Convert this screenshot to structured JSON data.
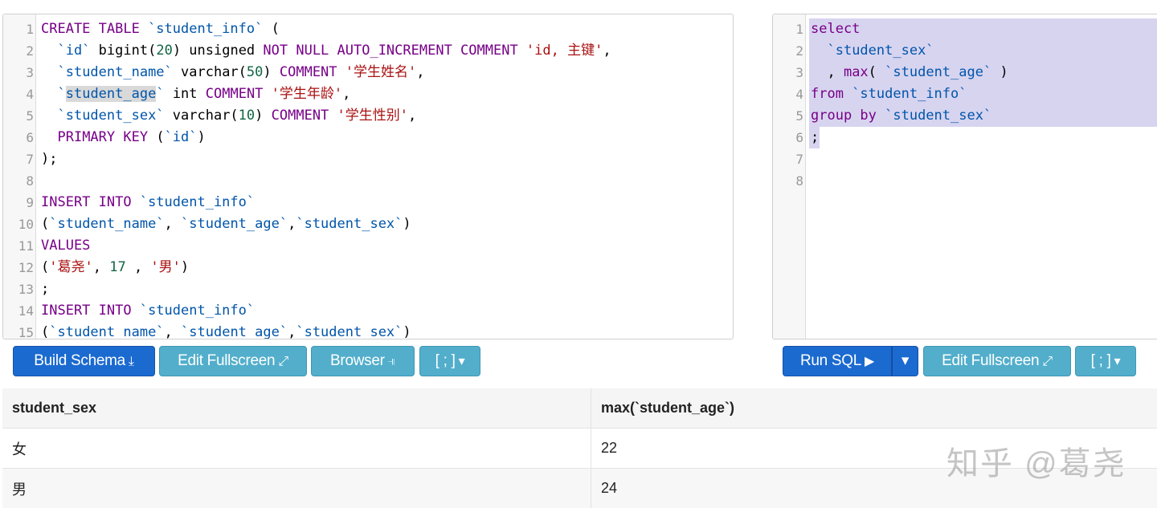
{
  "schema": {
    "lines": [
      {
        "n": "1",
        "parts": [
          {
            "t": "CREATE TABLE ",
            "c": "kw"
          },
          {
            "t": "`student_info`",
            "c": "var"
          },
          {
            "t": " (",
            "c": ""
          }
        ]
      },
      {
        "n": "2",
        "parts": [
          {
            "t": "  ",
            "c": ""
          },
          {
            "t": "`id`",
            "c": "var"
          },
          {
            "t": " bigint(",
            "c": ""
          },
          {
            "t": "20",
            "c": "num"
          },
          {
            "t": ") unsigned ",
            "c": ""
          },
          {
            "t": "NOT NULL AUTO_INCREMENT COMMENT ",
            "c": "kw"
          },
          {
            "t": "'id, 主键'",
            "c": "str"
          },
          {
            "t": ",",
            "c": ""
          }
        ]
      },
      {
        "n": "3",
        "parts": [
          {
            "t": "  ",
            "c": ""
          },
          {
            "t": "`student_name`",
            "c": "var"
          },
          {
            "t": " varchar(",
            "c": ""
          },
          {
            "t": "50",
            "c": "num"
          },
          {
            "t": ") ",
            "c": ""
          },
          {
            "t": "COMMENT ",
            "c": "kw"
          },
          {
            "t": "'学生姓名'",
            "c": "str"
          },
          {
            "t": ",",
            "c": ""
          }
        ]
      },
      {
        "n": "4",
        "parts": [
          {
            "t": "  ",
            "c": ""
          },
          {
            "t": "`",
            "c": "var"
          },
          {
            "t": "student_age",
            "c": "var hl"
          },
          {
            "t": "`",
            "c": "var"
          },
          {
            "t": " int ",
            "c": ""
          },
          {
            "t": "COMMENT ",
            "c": "kw"
          },
          {
            "t": "'学生年龄'",
            "c": "str"
          },
          {
            "t": ",",
            "c": ""
          }
        ]
      },
      {
        "n": "5",
        "parts": [
          {
            "t": "  ",
            "c": ""
          },
          {
            "t": "`student_sex`",
            "c": "var"
          },
          {
            "t": " varchar(",
            "c": ""
          },
          {
            "t": "10",
            "c": "num"
          },
          {
            "t": ") ",
            "c": ""
          },
          {
            "t": "COMMENT ",
            "c": "kw"
          },
          {
            "t": "'学生性别'",
            "c": "str"
          },
          {
            "t": ",",
            "c": ""
          }
        ]
      },
      {
        "n": "6",
        "parts": [
          {
            "t": "  ",
            "c": ""
          },
          {
            "t": "PRIMARY KEY",
            "c": "kw"
          },
          {
            "t": " (",
            "c": ""
          },
          {
            "t": "`id`",
            "c": "var"
          },
          {
            "t": ")",
            "c": ""
          }
        ]
      },
      {
        "n": "7",
        "parts": [
          {
            "t": ");",
            "c": ""
          }
        ]
      },
      {
        "n": "8",
        "parts": []
      },
      {
        "n": "9",
        "parts": [
          {
            "t": "INSERT INTO ",
            "c": "kw"
          },
          {
            "t": "`student_info`",
            "c": "var"
          }
        ]
      },
      {
        "n": "10",
        "parts": [
          {
            "t": "(",
            "c": ""
          },
          {
            "t": "`student_name`",
            "c": "var"
          },
          {
            "t": ", ",
            "c": ""
          },
          {
            "t": "`student_age`",
            "c": "var"
          },
          {
            "t": ",",
            "c": ""
          },
          {
            "t": "`student_sex`",
            "c": "var"
          },
          {
            "t": ")",
            "c": ""
          }
        ]
      },
      {
        "n": "11",
        "parts": [
          {
            "t": "VALUES",
            "c": "kw"
          }
        ]
      },
      {
        "n": "12",
        "parts": [
          {
            "t": "(",
            "c": ""
          },
          {
            "t": "'葛尧'",
            "c": "str"
          },
          {
            "t": ", ",
            "c": ""
          },
          {
            "t": "17",
            "c": "num"
          },
          {
            "t": " , ",
            "c": ""
          },
          {
            "t": "'男'",
            "c": "str"
          },
          {
            "t": ")",
            "c": ""
          }
        ]
      },
      {
        "n": "13",
        "parts": [
          {
            "t": ";",
            "c": ""
          }
        ]
      },
      {
        "n": "14",
        "parts": [
          {
            "t": "INSERT INTO ",
            "c": "kw"
          },
          {
            "t": "`student_info`",
            "c": "var"
          }
        ]
      },
      {
        "n": "15",
        "parts": [
          {
            "t": "(",
            "c": ""
          },
          {
            "t": "`student_name`",
            "c": "var"
          },
          {
            "t": ", ",
            "c": ""
          },
          {
            "t": "`student_age`",
            "c": "var"
          },
          {
            "t": ",",
            "c": ""
          },
          {
            "t": "`student_sex`",
            "c": "var"
          },
          {
            "t": ")",
            "c": ""
          }
        ]
      }
    ]
  },
  "query": {
    "lines": [
      {
        "n": "1",
        "sel": true,
        "parts": [
          {
            "t": "select",
            "c": "kw"
          }
        ]
      },
      {
        "n": "2",
        "sel": true,
        "parts": [
          {
            "t": "  ",
            "c": ""
          },
          {
            "t": "`student_sex`",
            "c": "var"
          }
        ]
      },
      {
        "n": "3",
        "sel": true,
        "parts": [
          {
            "t": "  , ",
            "c": ""
          },
          {
            "t": "max",
            "c": "kw"
          },
          {
            "t": "( ",
            "c": ""
          },
          {
            "t": "`student_age`",
            "c": "var"
          },
          {
            "t": " )",
            "c": ""
          }
        ]
      },
      {
        "n": "4",
        "sel": true,
        "parts": [
          {
            "t": "from ",
            "c": "kw"
          },
          {
            "t": "`student_info`",
            "c": "var"
          }
        ]
      },
      {
        "n": "5",
        "sel": true,
        "parts": [
          {
            "t": "group by ",
            "c": "kw"
          },
          {
            "t": "`student_sex`",
            "c": "var"
          }
        ]
      },
      {
        "n": "6",
        "sel": "short",
        "parts": [
          {
            "t": ";",
            "c": ""
          }
        ]
      },
      {
        "n": "7",
        "parts": []
      },
      {
        "n": "8",
        "parts": []
      }
    ]
  },
  "buttons": {
    "build_schema": "Build Schema",
    "edit_fullscreen": "Edit Fullscreen",
    "browser": "Browser",
    "delimiter": "[ ; ]",
    "run_sql": "Run SQL",
    "edit_fullscreen_2": "Edit Fullscreen",
    "delimiter_2": "[ ; ]"
  },
  "results": {
    "headers": [
      "student_sex",
      "max(`student_age`)"
    ],
    "rows": [
      [
        "女",
        "22"
      ],
      [
        "男",
        "24"
      ]
    ]
  },
  "watermark": "知乎 @葛尧",
  "colors": {
    "primary": "#1b6ad0",
    "info": "#52aecb",
    "selection": "#d7d4f0",
    "keyword": "#770088",
    "identifier": "#0055aa",
    "string": "#aa1111",
    "number": "#116644"
  }
}
